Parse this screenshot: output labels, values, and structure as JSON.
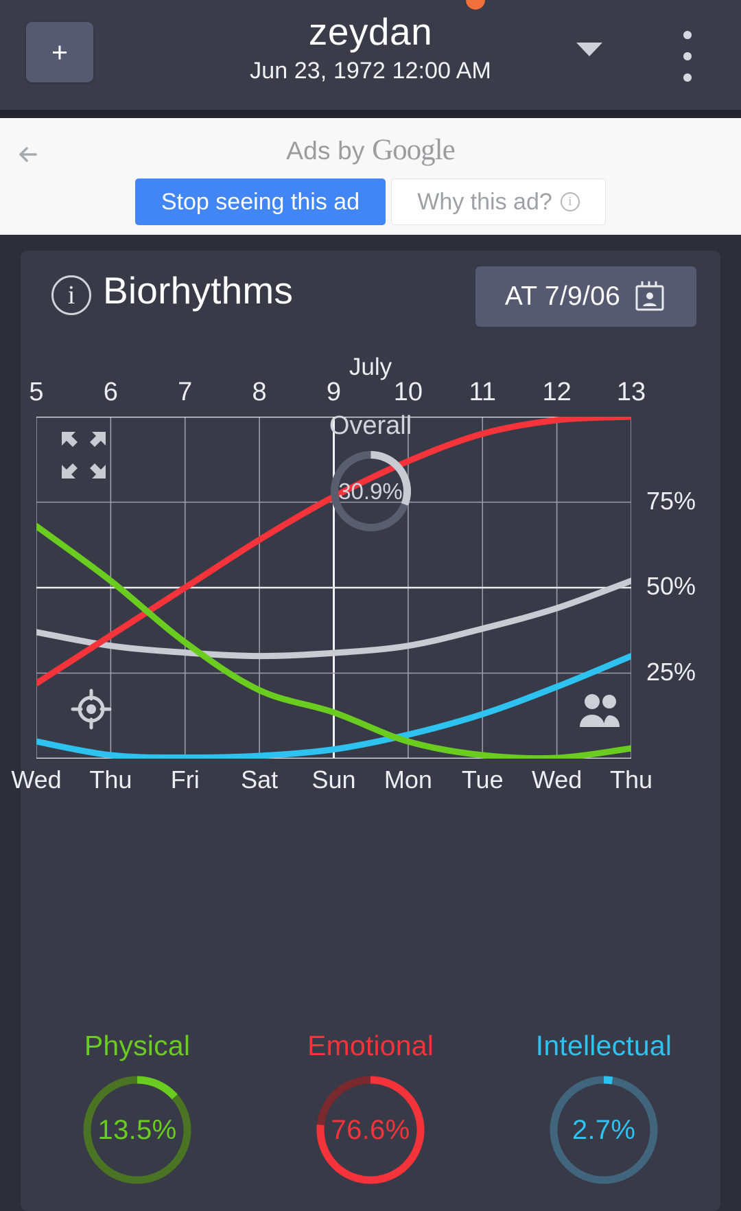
{
  "appbar": {
    "add_label": "+",
    "profile_name": "zeydan",
    "profile_date": "Jun 23, 1972 12:00 AM",
    "caret_icon": "chevron-down-icon",
    "overflow_icon": "more-vertical-icon",
    "notification_dot_color": "#f0703c",
    "background": "#3a3c4a"
  },
  "ad": {
    "back_icon": "arrow-left-icon",
    "label_prefix": "Ads by ",
    "label_brand": "Google",
    "stop_label": "Stop seeing this ad",
    "why_label": "Why this ad?",
    "why_info_icon": "info-icon",
    "stop_color": "#4285f4",
    "background": "#f8f8f8"
  },
  "card": {
    "info_icon": "info-icon",
    "title": "Biorhythms",
    "at_button_label": "AT 7/9/06",
    "at_button_icon": "contact-calendar-icon",
    "background": "#383a47"
  },
  "chart_overlay": {
    "expand_icon": "expand-arrows-icon",
    "locate_icon": "crosshair-target-icon",
    "people_icon": "people-group-icon"
  },
  "rings": [
    {
      "name": "Physical",
      "value": "13.5%",
      "pct": 13.5,
      "color": "#6ACC1F",
      "track": "#4a7324"
    },
    {
      "name": "Emotional",
      "value": "76.6%",
      "pct": 76.6,
      "color": "#F5333A",
      "track": "#7a2a2e"
    },
    {
      "name": "Intellectual",
      "value": "2.7%",
      "pct": 2.7,
      "color": "#2EC2F0",
      "track": "#41657d"
    }
  ],
  "overall": {
    "name": "Overall",
    "value": "30.9%",
    "pct": 30.9,
    "color": "#c9cbd2",
    "track": "#5a5d6e"
  },
  "chart_data": {
    "type": "line",
    "title": "Biorhythms",
    "xlabel": "July",
    "ylabel": "",
    "ylim": [
      0,
      100
    ],
    "grid": true,
    "legend": "bottom",
    "x": [
      5,
      6,
      7,
      8,
      9,
      10,
      11,
      12,
      13
    ],
    "tick_labels_top": [
      "5",
      "6",
      "7",
      "8",
      "9",
      "10",
      "11",
      "12",
      "13"
    ],
    "tick_labels_bottom": [
      "Wed",
      "Thu",
      "Fri",
      "Sat",
      "Sun",
      "Mon",
      "Tue",
      "Wed",
      "Thu"
    ],
    "ytick_labels": [
      "75%",
      "50%",
      "25%"
    ],
    "yticks": [
      75,
      50,
      25
    ],
    "highlighted_x": 9,
    "series": [
      {
        "name": "Physical",
        "color": "#6ACC1F",
        "values": [
          68.0,
          52.0,
          34.0,
          20.0,
          13.5,
          5.0,
          1.0,
          0.2,
          3.0
        ]
      },
      {
        "name": "Emotional",
        "color": "#F5333A",
        "values": [
          22.0,
          36.0,
          50.0,
          64.0,
          76.6,
          87.0,
          95.0,
          99.0,
          100.0
        ]
      },
      {
        "name": "Intellectual",
        "color": "#2EC2F0",
        "values": [
          5.0,
          1.0,
          0.3,
          0.8,
          2.7,
          7.0,
          13.0,
          21.0,
          30.0
        ]
      },
      {
        "name": "Overall",
        "color": "#c9cbd2",
        "values": [
          37.0,
          33.0,
          31.0,
          30.0,
          30.9,
          33.0,
          38.0,
          44.0,
          52.0
        ]
      }
    ]
  }
}
